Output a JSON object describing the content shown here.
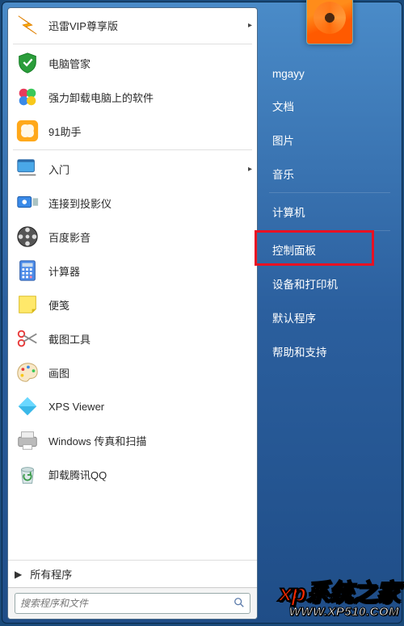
{
  "user": {
    "name": "mgayy"
  },
  "programs": [
    {
      "label": "迅雷VIP尊享版",
      "icon": "xunlei",
      "has_submenu": true
    },
    {
      "label": "电脑管家",
      "icon": "pcmanager",
      "has_submenu": false
    },
    {
      "label": "强力卸载电脑上的软件",
      "icon": "uninstall",
      "has_submenu": false
    },
    {
      "label": "91助手",
      "icon": "91helper",
      "has_submenu": false
    },
    {
      "label": "入门",
      "icon": "getstarted",
      "has_submenu": true
    },
    {
      "label": "连接到投影仪",
      "icon": "projector",
      "has_submenu": false
    },
    {
      "label": "百度影音",
      "icon": "baiduvideo",
      "has_submenu": false
    },
    {
      "label": "计算器",
      "icon": "calculator",
      "has_submenu": false
    },
    {
      "label": "便笺",
      "icon": "stickynote",
      "has_submenu": false
    },
    {
      "label": "截图工具",
      "icon": "snipping",
      "has_submenu": false
    },
    {
      "label": "画图",
      "icon": "paint",
      "has_submenu": false
    },
    {
      "label": "XPS Viewer",
      "icon": "xps",
      "has_submenu": false
    },
    {
      "label": "Windows 传真和扫描",
      "icon": "faxscan",
      "has_submenu": false
    },
    {
      "label": "卸载腾讯QQ",
      "icon": "recyclebin",
      "has_submenu": false
    }
  ],
  "all_programs_label": "所有程序",
  "search": {
    "placeholder": "搜索程序和文件"
  },
  "right_links": [
    {
      "label": "文档"
    },
    {
      "label": "图片"
    },
    {
      "label": "音乐"
    },
    {
      "label": "计算机"
    },
    {
      "label": "控制面板",
      "highlighted": true
    },
    {
      "label": "设备和打印机"
    },
    {
      "label": "默认程序"
    },
    {
      "label": "帮助和支持"
    }
  ],
  "watermark": {
    "brand_prefix": "xp",
    "brand_suffix": "系统之家",
    "url": "WWW.XP510.COM"
  }
}
